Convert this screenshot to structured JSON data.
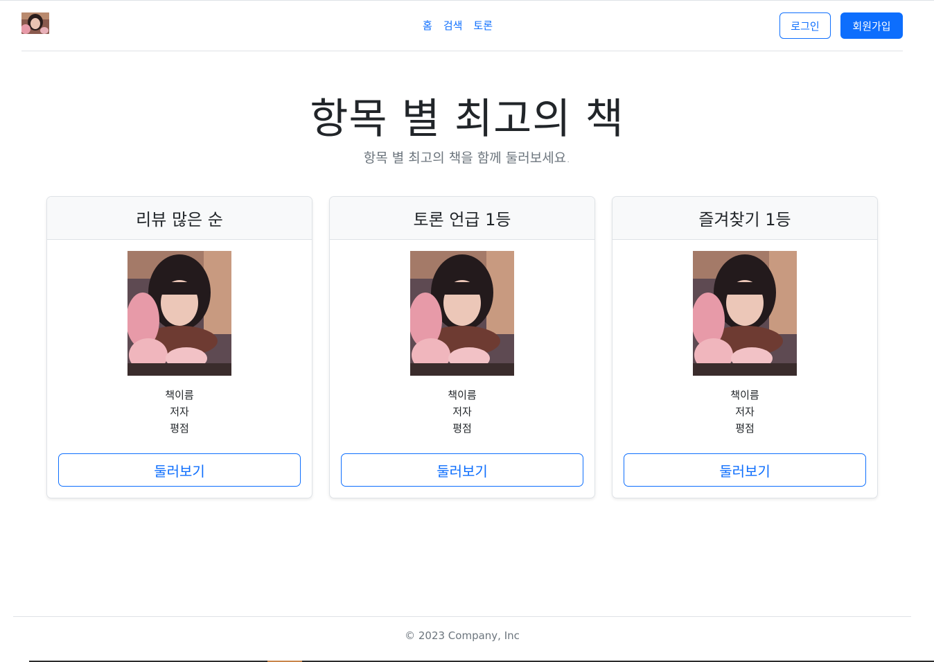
{
  "header": {
    "logo_alt": "logo",
    "nav": [
      "홈",
      "검색",
      "토론"
    ],
    "login_label": "로그인",
    "signup_label": "회원가입"
  },
  "hero": {
    "title": "항목 별 최고의 책",
    "subtitle": "항목 별 최고의 책을 함께 둘러보세요."
  },
  "cards": [
    {
      "title": "리뷰 많은 순",
      "book_name": "책이름",
      "author": "저자",
      "rating": "평점",
      "button": "둘러보기"
    },
    {
      "title": "토론 언급 1등",
      "book_name": "책이름",
      "author": "저자",
      "rating": "평점",
      "button": "둘러보기"
    },
    {
      "title": "즐겨찾기 1등",
      "book_name": "책이름",
      "author": "저자",
      "rating": "평점",
      "button": "둘러보기"
    }
  ],
  "footer": {
    "copyright": "© 2023 Company, Inc"
  },
  "colors": {
    "primary": "#0d6efd",
    "muted": "#6c757d",
    "border": "#dee2e6",
    "card_header_bg": "#f8f9fa"
  }
}
